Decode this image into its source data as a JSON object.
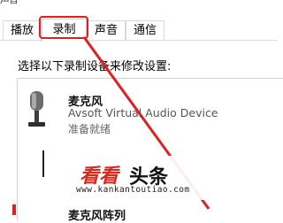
{
  "window": {
    "title_fragment": "声音"
  },
  "tabs": [
    {
      "label": "播放"
    },
    {
      "label": "录制"
    },
    {
      "label": "声音"
    },
    {
      "label": "通信"
    }
  ],
  "recording": {
    "instruction": "选择以下录制设备来修改设置:",
    "devices": [
      {
        "name": "麦克风",
        "description": "Avsoft Virtual Audio Device",
        "status": "准备就绪",
        "icon": "microphone-icon"
      },
      {
        "name": "麦克风阵列"
      }
    ]
  },
  "watermark": {
    "brand_kan": "看看",
    "brand_toutiao": "头条",
    "url": "www.kankantoutiao.com"
  },
  "colors": {
    "highlight": "#e02020",
    "watermark_red": "#d62a1e"
  }
}
